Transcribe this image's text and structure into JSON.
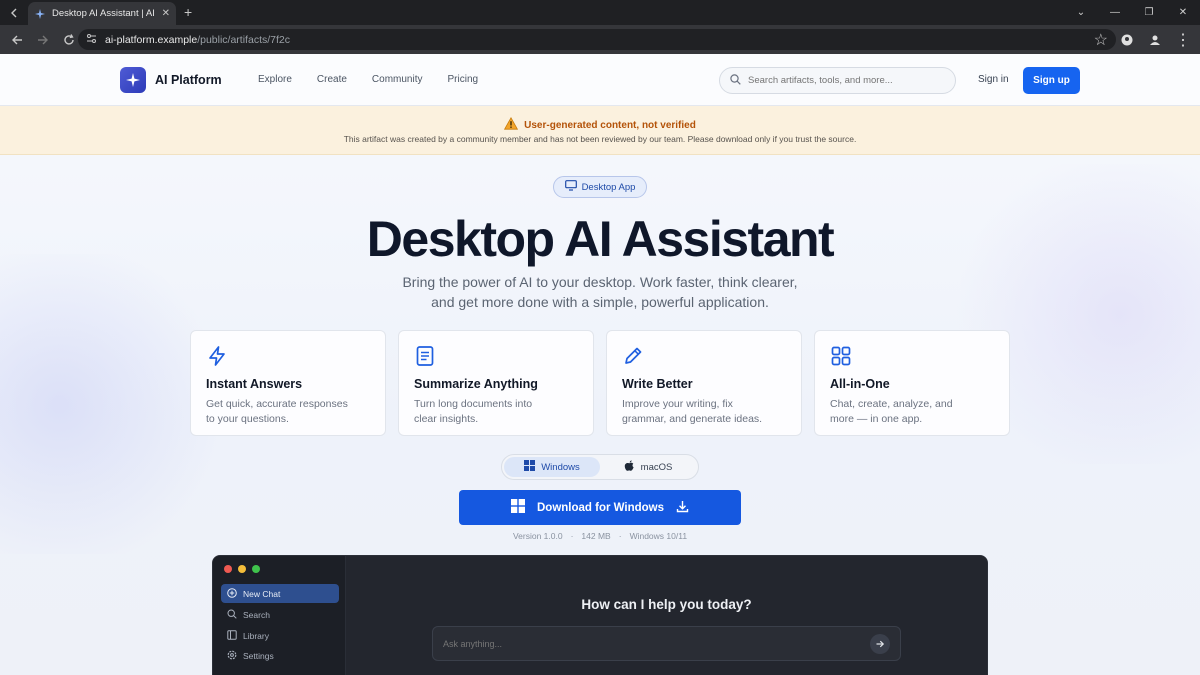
{
  "browser": {
    "tab_title": "Desktop AI Assistant | AI Platfo",
    "url_host": "ai-platform.example",
    "url_path": "/public/artifacts/7f2c"
  },
  "header": {
    "logo_text": "AI Platform",
    "nav": [
      "Explore",
      "Create",
      "Community",
      "Pricing"
    ],
    "search_placeholder": "Search artifacts, tools, and more...",
    "signin": "Sign in",
    "signup": "Sign up"
  },
  "warning": {
    "title": "User-generated content, not verified",
    "text": "This artifact was created by a community member and has not been reviewed by our team. Please download only if you trust the source."
  },
  "hero": {
    "badge": "Desktop App",
    "title": "Desktop AI Assistant",
    "subtitle_line1": "Bring the power of AI to your desktop. Work faster, think clearer,",
    "subtitle_line2": "and get more done with a simple, powerful application."
  },
  "features": [
    {
      "icon": "lightning-icon",
      "title": "Instant Answers",
      "desc1": "Get quick, accurate responses",
      "desc2": "to your questions."
    },
    {
      "icon": "document-icon",
      "title": "Summarize Anything",
      "desc1": "Turn long documents into",
      "desc2": "clear insights."
    },
    {
      "icon": "pencil-icon",
      "title": "Write Better",
      "desc1": "Improve your writing, fix",
      "desc2": "grammar, and generate ideas."
    },
    {
      "icon": "grid-icon",
      "title": "All-in-One",
      "desc1": "Chat, create, analyze, and",
      "desc2": "more — in one app."
    }
  ],
  "os_toggle": {
    "windows": "Windows",
    "macos": "macOS",
    "selected": "Windows"
  },
  "download": {
    "label": "Download for Windows"
  },
  "meta": {
    "version": "Version 1.0.0",
    "size": "142 MB",
    "os": "Windows 10/11",
    "sep": "·"
  },
  "app_preview": {
    "sidebar": [
      "New Chat",
      "Search",
      "Library",
      "Settings"
    ],
    "question": "How can I help you today?",
    "ask_placeholder": "Ask anything..."
  },
  "colors": {
    "accent": "#1664f0",
    "warning_bg": "#fbf1de",
    "warning_text": "#b45309"
  }
}
